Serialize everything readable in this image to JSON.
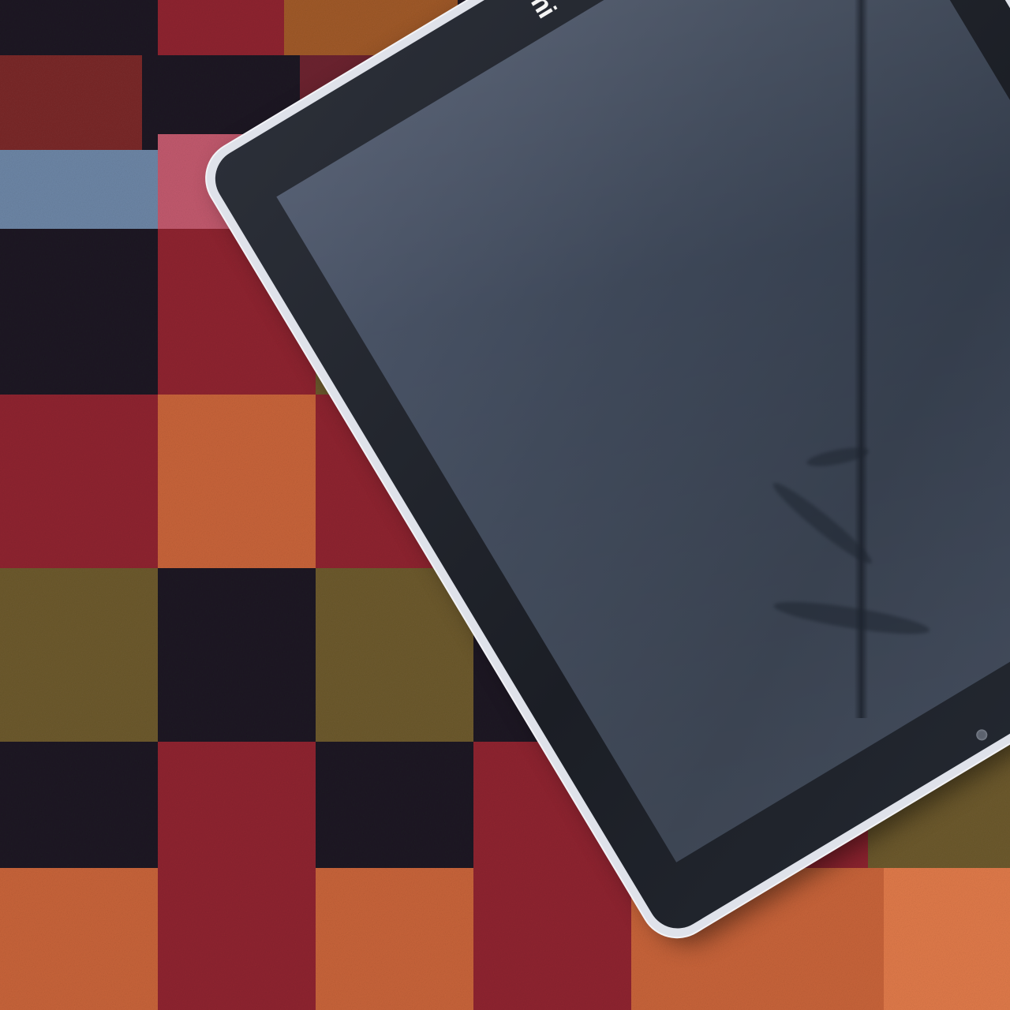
{
  "scene": {
    "subject": "tablet",
    "background": "plaid-fabric",
    "colors": {
      "fabric_red": "#8f2530",
      "fabric_dark": "#1c1a22",
      "fabric_blue": "#6d86a6",
      "fabric_cream": "#e8dcc4",
      "fabric_orange": "#c8643a",
      "fabric_olive": "#6d5a2e",
      "tablet_frame": "#dfe2ea",
      "tablet_bezel": "#22262e",
      "tablet_screen": "#3a4455"
    }
  },
  "tablet": {
    "brand_logo": "mi",
    "screen_state": "off"
  }
}
